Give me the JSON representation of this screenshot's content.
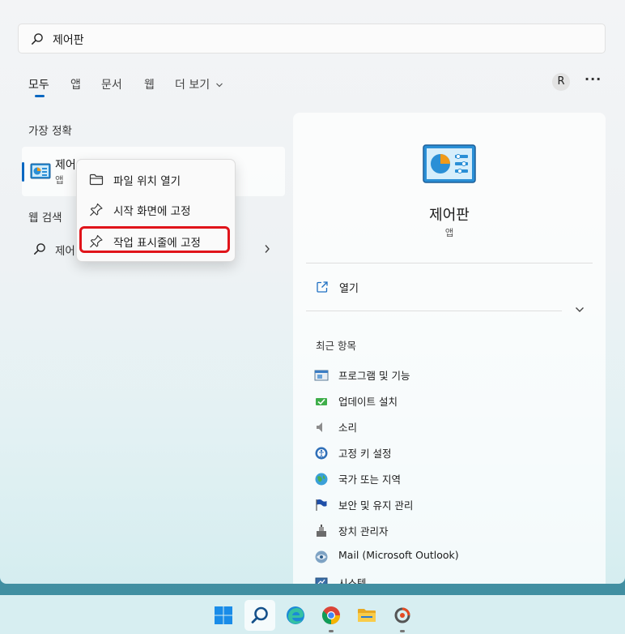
{
  "search": {
    "query": "제어판",
    "icon": "search-icon"
  },
  "tabs": [
    {
      "label": "모두",
      "active": true
    },
    {
      "label": "앱"
    },
    {
      "label": "문서"
    },
    {
      "label": "웹"
    },
    {
      "label": "더 보기"
    }
  ],
  "header": {
    "avatar_initial": "R",
    "more": "···"
  },
  "best_match": {
    "section_title": "가장 정확",
    "name": "제어",
    "type": "앱"
  },
  "web_search": {
    "section_title": "웹 검색",
    "query": "제어"
  },
  "context_menu": {
    "items": [
      {
        "label": "파일 위치 열기",
        "icon": "folder-icon"
      },
      {
        "label": "시작 화면에 고정",
        "icon": "pin-icon"
      },
      {
        "label": "작업 표시줄에 고정",
        "icon": "pin-icon",
        "highlighted": true
      }
    ],
    "highlight_color": "#e0141a"
  },
  "detail": {
    "name": "제어판",
    "type": "앱",
    "open_label": "열기",
    "recent_title": "최근 항목",
    "recent": [
      {
        "label": "프로그램 및 기능",
        "icon": "programs-icon"
      },
      {
        "label": "업데이트 설치",
        "icon": "update-icon"
      },
      {
        "label": "소리",
        "icon": "speaker-icon"
      },
      {
        "label": "고정 키 설정",
        "icon": "accessibility-icon"
      },
      {
        "label": "국가 또는 지역",
        "icon": "globe-icon"
      },
      {
        "label": "보안 및 유지 관리",
        "icon": "flag-icon"
      },
      {
        "label": "장치 관리자",
        "icon": "device-manager-icon"
      },
      {
        "label": "Mail (Microsoft Outlook)",
        "icon": "mail-icon"
      },
      {
        "label": "시스템",
        "icon": "system-icon"
      }
    ]
  },
  "taskbar": {
    "items": [
      {
        "name": "start-button",
        "icon": "windows-logo-icon"
      },
      {
        "name": "search-button",
        "icon": "search-icon",
        "active": true
      },
      {
        "name": "edge-button",
        "icon": "edge-icon"
      },
      {
        "name": "chrome-button",
        "icon": "chrome-icon",
        "running": true
      },
      {
        "name": "file-explorer-button",
        "icon": "folder-icon"
      },
      {
        "name": "app-button",
        "icon": "app-icon",
        "running": true
      }
    ]
  },
  "colors": {
    "accent": "#0a67c1",
    "highlight": "#e0141a"
  }
}
